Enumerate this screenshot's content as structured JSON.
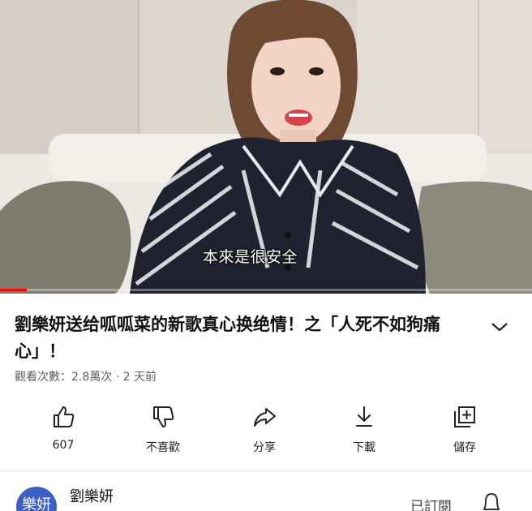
{
  "video": {
    "subtitle": "本來是很安全",
    "progress_fraction": 0.05,
    "colors": {
      "progress": "#ff0000"
    }
  },
  "title": "劉樂妍送给呱呱菜的新歌真心换绝情！之「人死不如狗痛心」！",
  "expand_icon": "chevron-down-icon",
  "meta": "觀看次數：2.8萬次 · 2 天前",
  "actions": [
    {
      "icon": "thumbs-up-icon",
      "label": "607"
    },
    {
      "icon": "thumbs-down-icon",
      "label": "不喜歡"
    },
    {
      "icon": "share-icon",
      "label": "分享"
    },
    {
      "icon": "download-icon",
      "label": "下載"
    },
    {
      "icon": "save-to-playlist-icon",
      "label": "儲存"
    }
  ],
  "channel": {
    "avatar_text": "樂妍",
    "name": "劉樂妍",
    "subscribe_label": "已訂閱",
    "bell_icon": "bell-icon"
  }
}
